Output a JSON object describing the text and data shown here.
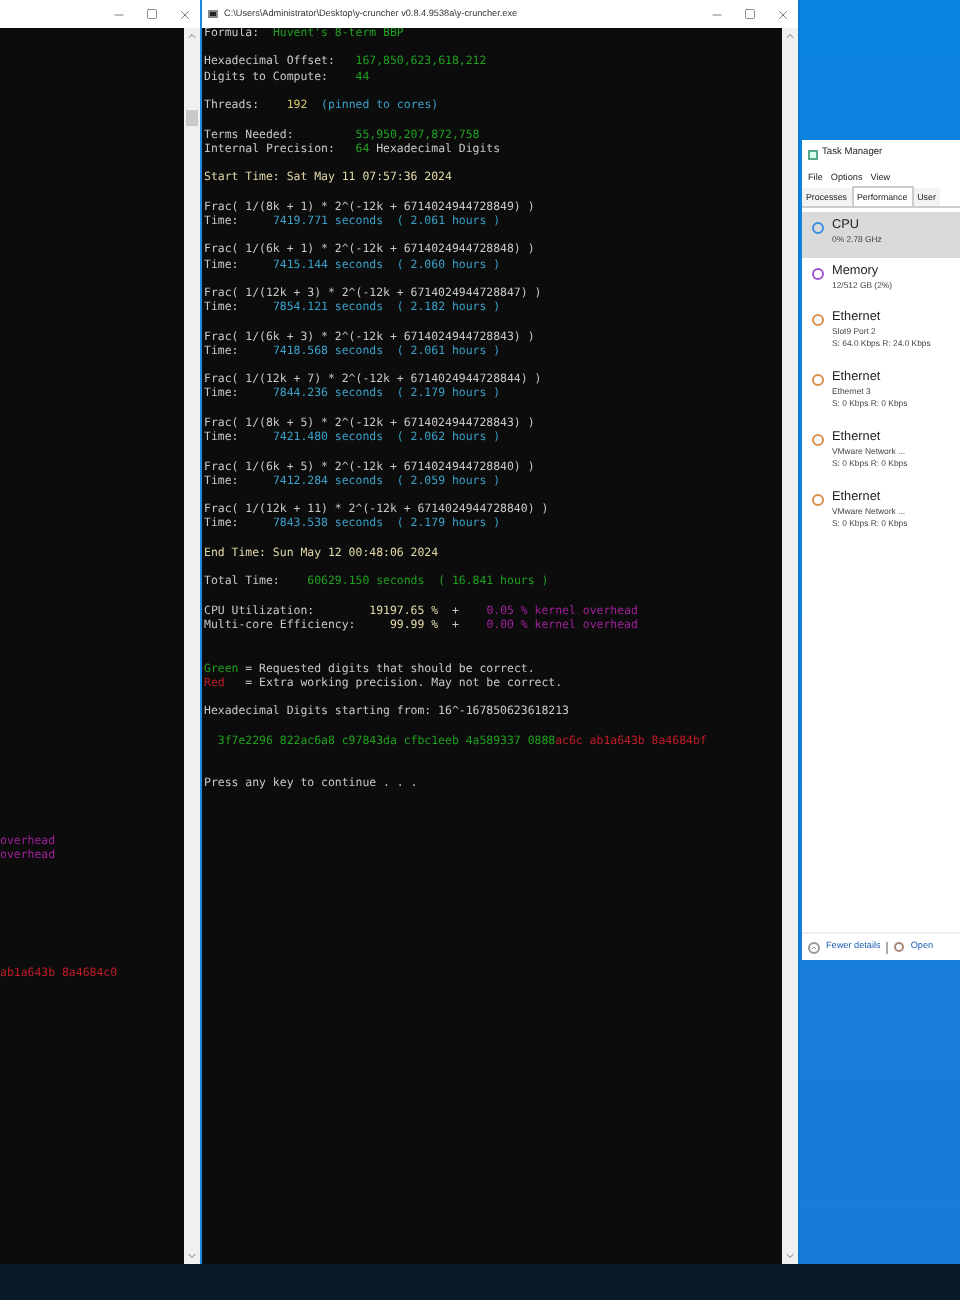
{
  "left_console": {
    "lines": [
      {
        "kind": "gap_big"
      },
      {
        "kind": "text",
        "segments": [
          {
            "text": "overhead",
            "color": "#a0209a"
          }
        ]
      },
      {
        "kind": "text",
        "segments": [
          {
            "text": "overhead",
            "color": "#a0209a"
          }
        ]
      },
      {
        "kind": "gap_mid"
      },
      {
        "kind": "text",
        "segments": [
          {
            "text": "ab1a643b 8a4684c0",
            "color": "#c01c28"
          }
        ]
      }
    ]
  },
  "console": {
    "title": "C:\\Users\\Administrator\\Desktop\\y-cruncher v0.8.4.9538a\\y-cruncher.exe",
    "lines": [
      {
        "kind": "text",
        "segments": [
          {
            "text": "Formula:  ",
            "color": "#c8c8c8"
          },
          {
            "text": "Huvent's 8-term BBP",
            "color": "#1fa01f"
          }
        ]
      },
      {
        "kind": "blank"
      },
      {
        "kind": "text",
        "segments": [
          {
            "text": "Hexadecimal Offset:   ",
            "color": "#c8c8c8"
          },
          {
            "text": "167,850,623,618,212",
            "color": "#1fa01f"
          }
        ]
      },
      {
        "kind": "text",
        "segments": [
          {
            "text": "Digits to Compute:    ",
            "color": "#c8c8c8"
          },
          {
            "text": "44",
            "color": "#1fa01f"
          }
        ]
      },
      {
        "kind": "blank"
      },
      {
        "kind": "text",
        "segments": [
          {
            "text": "Threads:    ",
            "color": "#c8c8c8"
          },
          {
            "text": "192",
            "color": "#d8c870"
          },
          {
            "text": "  (pinned to cores)",
            "color": "#3aa0c8"
          }
        ]
      },
      {
        "kind": "blank"
      },
      {
        "kind": "text",
        "segments": [
          {
            "text": "Terms Needed:         ",
            "color": "#c8c8c8"
          },
          {
            "text": "55,950,207,872,758",
            "color": "#1fa01f"
          }
        ]
      },
      {
        "kind": "text",
        "segments": [
          {
            "text": "Internal Precision:   ",
            "color": "#c8c8c8"
          },
          {
            "text": "64",
            "color": "#1fa01f"
          },
          {
            "text": " Hexadecimal Digits",
            "color": "#c8c8c8"
          }
        ]
      },
      {
        "kind": "blank"
      },
      {
        "kind": "text",
        "segments": [
          {
            "text": "Start Time: Sat May 11 07:57:36 2024",
            "color": "#e0d8a8"
          }
        ]
      },
      {
        "kind": "blank"
      },
      {
        "kind": "text",
        "segments": [
          {
            "text": "Frac( 1/(8k + 1) * 2^(-12k + 6714024944728849) )",
            "color": "#c8c8c8"
          }
        ]
      },
      {
        "kind": "text",
        "segments": [
          {
            "text": "Time:     ",
            "color": "#c8c8c8"
          },
          {
            "text": "7419.771 seconds  ( 2.061 hours )",
            "color": "#3aa0c8"
          }
        ]
      },
      {
        "kind": "blank"
      },
      {
        "kind": "text",
        "segments": [
          {
            "text": "Frac( 1/(6k + 1) * 2^(-12k + 6714024944728848) )",
            "color": "#c8c8c8"
          }
        ]
      },
      {
        "kind": "text",
        "segments": [
          {
            "text": "Time:     ",
            "color": "#c8c8c8"
          },
          {
            "text": "7415.144 seconds  ( 2.060 hours )",
            "color": "#3aa0c8"
          }
        ]
      },
      {
        "kind": "blank"
      },
      {
        "kind": "text",
        "segments": [
          {
            "text": "Frac( 1/(12k + 3) * 2^(-12k + 6714024944728847) )",
            "color": "#c8c8c8"
          }
        ]
      },
      {
        "kind": "text",
        "segments": [
          {
            "text": "Time:     ",
            "color": "#c8c8c8"
          },
          {
            "text": "7854.121 seconds  ( 2.182 hours )",
            "color": "#3aa0c8"
          }
        ]
      },
      {
        "kind": "blank"
      },
      {
        "kind": "text",
        "segments": [
          {
            "text": "Frac( 1/(6k + 3) * 2^(-12k + 6714024944728843) )",
            "color": "#c8c8c8"
          }
        ]
      },
      {
        "kind": "text",
        "segments": [
          {
            "text": "Time:     ",
            "color": "#c8c8c8"
          },
          {
            "text": "7418.568 seconds  ( 2.061 hours )",
            "color": "#3aa0c8"
          }
        ]
      },
      {
        "kind": "blank"
      },
      {
        "kind": "text",
        "segments": [
          {
            "text": "Frac( 1/(12k + 7) * 2^(-12k + 6714024944728844) )",
            "color": "#c8c8c8"
          }
        ]
      },
      {
        "kind": "text",
        "segments": [
          {
            "text": "Time:     ",
            "color": "#c8c8c8"
          },
          {
            "text": "7844.236 seconds  ( 2.179 hours )",
            "color": "#3aa0c8"
          }
        ]
      },
      {
        "kind": "blank"
      },
      {
        "kind": "text",
        "segments": [
          {
            "text": "Frac( 1/(8k + 5) * 2^(-12k + 6714024944728843) )",
            "color": "#c8c8c8"
          }
        ]
      },
      {
        "kind": "text",
        "segments": [
          {
            "text": "Time:     ",
            "color": "#c8c8c8"
          },
          {
            "text": "7421.480 seconds  ( 2.062 hours )",
            "color": "#3aa0c8"
          }
        ]
      },
      {
        "kind": "blank"
      },
      {
        "kind": "text",
        "segments": [
          {
            "text": "Frac( 1/(6k + 5) * 2^(-12k + 6714024944728840) )",
            "color": "#c8c8c8"
          }
        ]
      },
      {
        "kind": "text",
        "segments": [
          {
            "text": "Time:     ",
            "color": "#c8c8c8"
          },
          {
            "text": "7412.284 seconds  ( 2.059 hours )",
            "color": "#3aa0c8"
          }
        ]
      },
      {
        "kind": "blank"
      },
      {
        "kind": "text",
        "segments": [
          {
            "text": "Frac( 1/(12k + 11) * 2^(-12k + 6714024944728840) )",
            "color": "#c8c8c8"
          }
        ]
      },
      {
        "kind": "text",
        "segments": [
          {
            "text": "Time:     ",
            "color": "#c8c8c8"
          },
          {
            "text": "7843.538 seconds  ( 2.179 hours )",
            "color": "#3aa0c8"
          }
        ]
      },
      {
        "kind": "blank"
      },
      {
        "kind": "text",
        "segments": [
          {
            "text": "End Time: Sun May 12 00:48:06 2024",
            "color": "#e0d8a8"
          }
        ]
      },
      {
        "kind": "blank"
      },
      {
        "kind": "text",
        "segments": [
          {
            "text": "Total Time:    ",
            "color": "#c8c8c8"
          },
          {
            "text": "60629.150 seconds  ( 16.841 hours )",
            "color": "#1fa01f"
          }
        ]
      },
      {
        "kind": "blank"
      },
      {
        "kind": "text",
        "segments": [
          {
            "text": "CPU Utilization:        ",
            "color": "#c8c8c8"
          },
          {
            "text": "19197.65 %",
            "color": "#e0d8a8"
          },
          {
            "text": "  +    ",
            "color": "#c8c8c8"
          },
          {
            "text": "0.05 % kernel overhead",
            "color": "#a0209a"
          }
        ]
      },
      {
        "kind": "text",
        "segments": [
          {
            "text": "Multi-core Efficiency:     ",
            "color": "#c8c8c8"
          },
          {
            "text": "99.99 %",
            "color": "#e0d8a8"
          },
          {
            "text": "  +    ",
            "color": "#c8c8c8"
          },
          {
            "text": "0.00 % kernel overhead",
            "color": "#a0209a"
          }
        ]
      },
      {
        "kind": "blank"
      },
      {
        "kind": "blank"
      },
      {
        "kind": "text",
        "segments": [
          {
            "text": "Green",
            "color": "#1fa01f"
          },
          {
            "text": " = Requested digits that should be correct.",
            "color": "#c8c8c8"
          }
        ]
      },
      {
        "kind": "text",
        "segments": [
          {
            "text": "Red",
            "color": "#c01c28"
          },
          {
            "text": "   = Extra working precision. May not be correct.",
            "color": "#c8c8c8"
          }
        ]
      },
      {
        "kind": "blank"
      },
      {
        "kind": "text",
        "segments": [
          {
            "text": "Hexadecimal Digits starting from: 16^-167850623618213",
            "color": "#c8c8c8"
          }
        ]
      },
      {
        "kind": "blank"
      },
      {
        "kind": "text",
        "segments": [
          {
            "text": "  3f7e2296 822ac6a8 c97843da cfbc1eeb 4a589337 0888",
            "color": "#1fa01f"
          },
          {
            "text": "ac6c ab1a643b 8a4684bf",
            "color": "#c01c28"
          }
        ]
      },
      {
        "kind": "blank"
      },
      {
        "kind": "blank"
      },
      {
        "kind": "text",
        "segments": [
          {
            "text": "Press any key to continue . . .",
            "color": "#c8c8c8"
          }
        ]
      }
    ]
  },
  "task_manager": {
    "title": "Task Manager",
    "menu": [
      "File",
      "Options",
      "View"
    ],
    "tabs": [
      {
        "label": "Processes",
        "selected": false
      },
      {
        "label": "Performance",
        "selected": true
      },
      {
        "label": "User",
        "selected": false
      }
    ],
    "items": [
      {
        "name": "CPU",
        "lines": [
          "0% 2.78 GHz"
        ],
        "color": "#3c8ee0",
        "selected": true
      },
      {
        "name": "Memory",
        "lines": [
          "12/512 GB (2%)"
        ],
        "color": "#a050d0",
        "selected": false
      },
      {
        "name": "Ethernet",
        "lines": [
          "Slot9 Port 2",
          "S: 64.0 Kbps R: 24.0 Kbps"
        ],
        "color": "#d89050",
        "selected": false
      },
      {
        "name": "Ethernet",
        "lines": [
          "Ethernet 3",
          "S: 0 Kbps R: 0 Kbps"
        ],
        "color": "#d89050",
        "selected": false
      },
      {
        "name": "Ethernet",
        "lines": [
          "VMware Network ...",
          "S: 0 Kbps R: 0 Kbps"
        ],
        "color": "#d89050",
        "selected": false
      },
      {
        "name": "Ethernet",
        "lines": [
          "VMware Network ...",
          "S: 0 Kbps R: 0 Kbps"
        ],
        "color": "#d89050",
        "selected": false
      }
    ],
    "footer": {
      "fewer": "Fewer details",
      "open": "Open"
    }
  }
}
